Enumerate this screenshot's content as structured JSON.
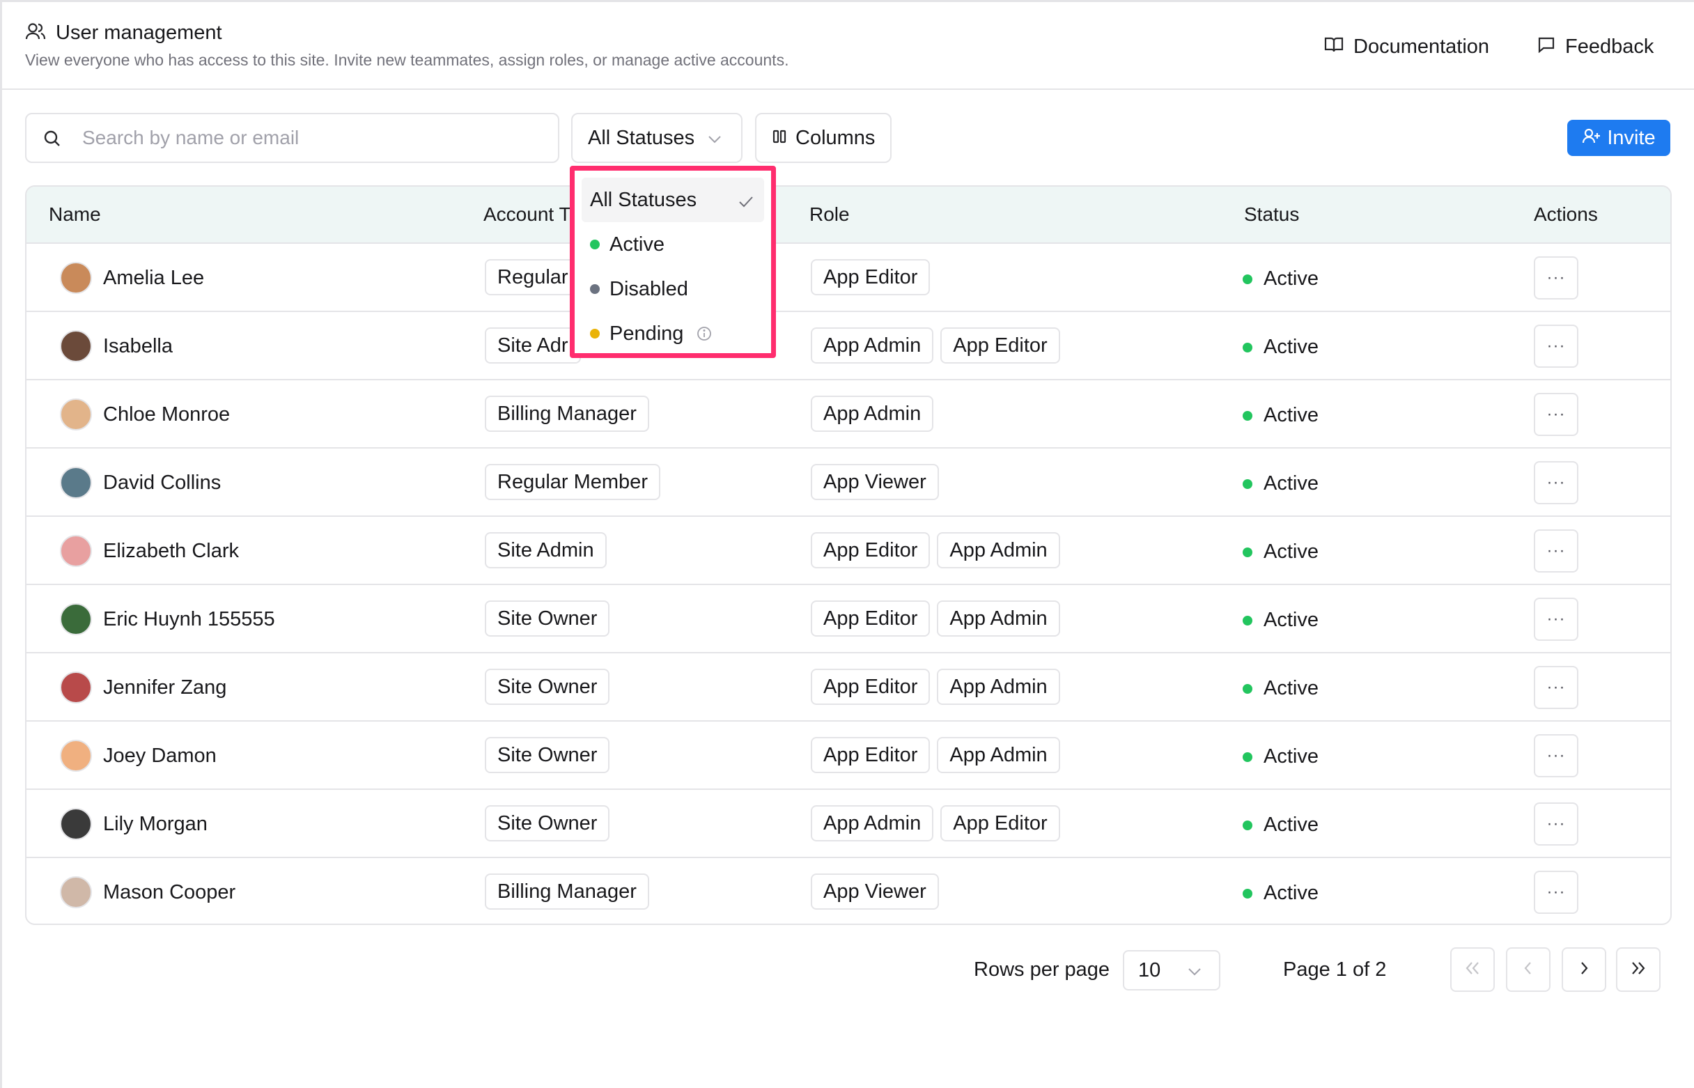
{
  "header": {
    "title": "User management",
    "subtitle": "View everyone who has access to this site. Invite new teammates, assign roles, or manage active accounts.",
    "documentation": "Documentation",
    "feedback": "Feedback"
  },
  "toolbar": {
    "search_placeholder": "Search by name or email",
    "status_filter": "All Statuses",
    "columns_label": "Columns",
    "invite_label": "Invite"
  },
  "table": {
    "headers": {
      "name": "Name",
      "account": "Account T",
      "role": "Role",
      "status": "Status",
      "actions": "Actions"
    },
    "rows": [
      {
        "name": "Amelia Lee",
        "account": "Regular",
        "roles": [
          "App Editor"
        ],
        "status": "Active"
      },
      {
        "name": "Isabella",
        "account": "Site Adr",
        "roles": [
          "App Admin",
          "App Editor"
        ],
        "status": "Active"
      },
      {
        "name": "Chloe Monroe",
        "account": "Billing Manager",
        "roles": [
          "App Admin"
        ],
        "status": "Active"
      },
      {
        "name": "David Collins",
        "account": "Regular Member",
        "roles": [
          "App Viewer"
        ],
        "status": "Active"
      },
      {
        "name": "Elizabeth Clark",
        "account": "Site Admin",
        "roles": [
          "App Editor",
          "App Admin"
        ],
        "status": "Active"
      },
      {
        "name": "Eric Huynh 155555",
        "account": "Site Owner",
        "roles": [
          "App Editor",
          "App Admin"
        ],
        "status": "Active"
      },
      {
        "name": "Jennifer Zang",
        "account": "Site Owner",
        "roles": [
          "App Editor",
          "App Admin"
        ],
        "status": "Active"
      },
      {
        "name": "Joey Damon",
        "account": "Site Owner",
        "roles": [
          "App Editor",
          "App Admin"
        ],
        "status": "Active"
      },
      {
        "name": "Lily Morgan",
        "account": "Site Owner",
        "roles": [
          "App Admin",
          "App Editor"
        ],
        "status": "Active"
      },
      {
        "name": "Mason Cooper",
        "account": "Billing Manager",
        "roles": [
          "App Viewer"
        ],
        "status": "Active"
      }
    ],
    "actions_glyph": "···"
  },
  "status_dropdown": {
    "items": [
      {
        "label": "All Statuses",
        "selected": true,
        "dot_color": ""
      },
      {
        "label": "Active",
        "selected": false,
        "dot_color": "#22c55e"
      },
      {
        "label": "Disabled",
        "selected": false,
        "dot_color": "#6b7280"
      },
      {
        "label": "Pending",
        "selected": false,
        "dot_color": "#eab308",
        "info_icon": "info-icon"
      }
    ]
  },
  "pagination": {
    "rows_per_page_label": "Rows per page",
    "rows_per_page_value": "10",
    "page_label": "Page 1 of 2"
  },
  "colors": {
    "accent": "#1e7bf0",
    "active": "#22c55e",
    "highlight_border": "#ff2d6e",
    "header_bg": "#eef6f5"
  },
  "avatar_colors": [
    "#c98a5a",
    "#6b4a3a",
    "#e2b48a",
    "#5a7a8a",
    "#e8a0a0",
    "#3a6b3a",
    "#b84a4a",
    "#f0b080",
    "#3a3a3a",
    "#d0b8a8"
  ]
}
